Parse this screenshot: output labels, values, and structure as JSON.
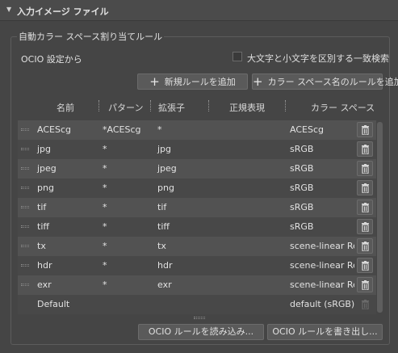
{
  "panel": {
    "title": "入力イメージ ファイル",
    "group_title": "自動カラー スペース割り当てルール",
    "ocio_label": "OCIO 設定から",
    "case_checkbox_label": "大文字と小文字を区別する一致検索",
    "case_checkbox_checked": false,
    "add_rule_label": "新規ルールを追加",
    "add_cs_rule_label": "カラー スペース名のルールを追加",
    "load_label": "OCIO ルールを読み込み...",
    "save_label": "OCIO ルールを書き出し..."
  },
  "table": {
    "headers": [
      "名前",
      "パターン",
      "拡張子",
      "正規表現",
      "カラー スペース"
    ],
    "rows": [
      {
        "name": "ACEScg",
        "pattern": "*ACEScg",
        "ext": "*",
        "regex": "",
        "cs": "ACEScg"
      },
      {
        "name": "jpg",
        "pattern": "*",
        "ext": "jpg",
        "regex": "",
        "cs": "sRGB"
      },
      {
        "name": "jpeg",
        "pattern": "*",
        "ext": "jpeg",
        "regex": "",
        "cs": "sRGB"
      },
      {
        "name": "png",
        "pattern": "*",
        "ext": "png",
        "regex": "",
        "cs": "sRGB"
      },
      {
        "name": "tif",
        "pattern": "*",
        "ext": "tif",
        "regex": "",
        "cs": "sRGB"
      },
      {
        "name": "tiff",
        "pattern": "*",
        "ext": "tiff",
        "regex": "",
        "cs": "sRGB"
      },
      {
        "name": "tx",
        "pattern": "*",
        "ext": "tx",
        "regex": "",
        "cs": "scene-linear Rec"
      },
      {
        "name": "hdr",
        "pattern": "*",
        "ext": "hdr",
        "regex": "",
        "cs": "scene-linear Rec"
      },
      {
        "name": "exr",
        "pattern": "*",
        "ext": "exr",
        "regex": "",
        "cs": "scene-linear Rec"
      },
      {
        "name": "Default",
        "pattern": "",
        "ext": "",
        "regex": "",
        "cs": "default (sRGB)"
      }
    ]
  },
  "icons": {
    "collapse": "triangle-down-icon",
    "add": "plus-icon",
    "delete": "trash-icon",
    "grip": "drag-handle-icon"
  },
  "colors": {
    "background": "#454545",
    "row_light": "#525252",
    "row_dark": "#484848",
    "button": "#5a5a5a",
    "text": "#e0e0e0"
  }
}
